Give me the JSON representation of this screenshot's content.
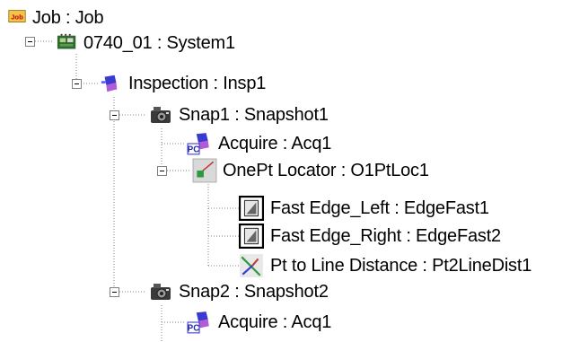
{
  "tree": {
    "root": "Job : Job",
    "system": "0740_01 : System1",
    "inspection": "Inspection : Insp1",
    "snap1": "Snap1 : Snapshot1",
    "acquire1": "Acquire : Acq1",
    "locator": "OnePt Locator : O1PtLoc1",
    "edge_left": "Fast Edge_Left : EdgeFast1",
    "edge_right": "Fast Edge_Right : EdgeFast2",
    "pt_line": "Pt to Line Distance : Pt2LineDist1",
    "snap2": "Snap2 : Snapshot2",
    "acquire2": "Acquire : Acq1"
  },
  "icons": {
    "job": "job-icon",
    "system": "circuit-board-icon",
    "inspection": "inspection-icon",
    "snapshot": "camera-icon",
    "acquire": "acquire-icon",
    "locator": "locator-icon",
    "edge": "edge-icon",
    "distance": "distance-icon"
  },
  "colors": {
    "job_icon_bg": "#f3c34a",
    "job_icon_text": "#c00000",
    "tree_line": "#808080"
  }
}
